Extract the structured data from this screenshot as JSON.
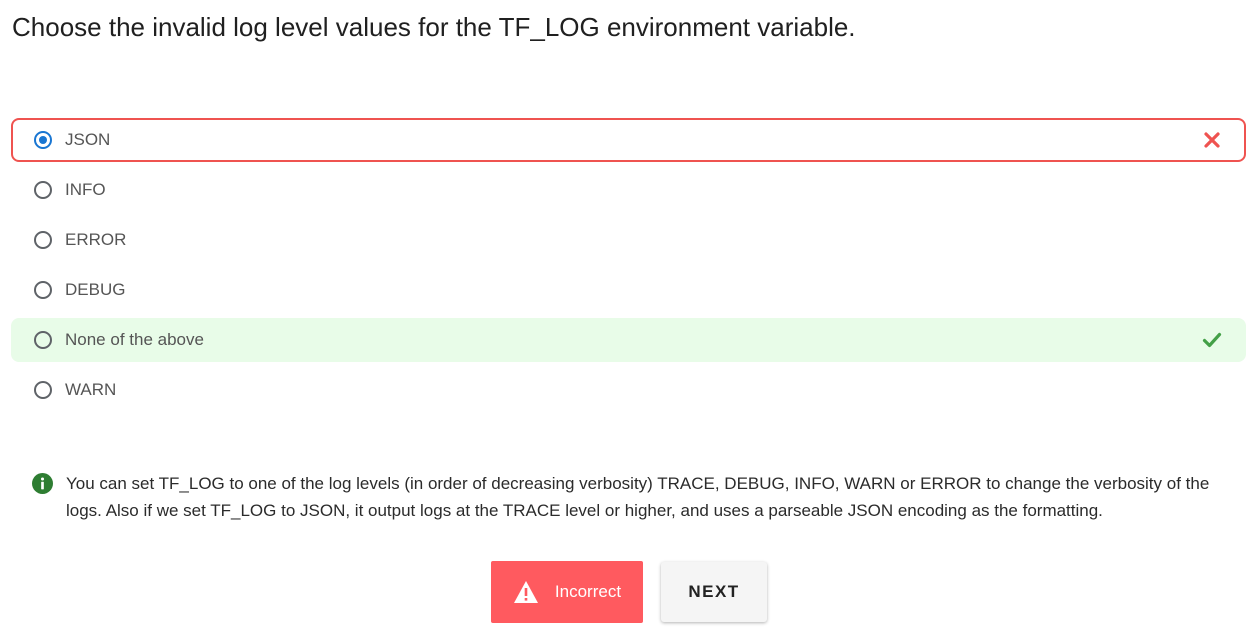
{
  "question": {
    "text": "Choose the invalid log level values for the TF_LOG environment variable."
  },
  "options": [
    {
      "label": "JSON",
      "selected": true,
      "state": "wrong"
    },
    {
      "label": "INFO",
      "selected": false,
      "state": "none"
    },
    {
      "label": "ERROR",
      "selected": false,
      "state": "none"
    },
    {
      "label": "DEBUG",
      "selected": false,
      "state": "none"
    },
    {
      "label": "None of the above",
      "selected": false,
      "state": "correct"
    },
    {
      "label": "WARN",
      "selected": false,
      "state": "none"
    }
  ],
  "explanation": {
    "icon": "info-icon",
    "text": "You can set TF_LOG to one of the log levels (in order of decreasing verbosity) TRACE, DEBUG, INFO, WARN or ERROR to change the verbosity of the logs. Also if we set TF_LOG to JSON, it output logs at the TRACE level or higher, and uses a parseable JSON encoding as the formatting."
  },
  "actions": {
    "incorrect_label": "Incorrect",
    "next_label": "NEXT"
  },
  "colors": {
    "wrong": "#ef5350",
    "correct_bg": "#e8fce8",
    "correct_check": "#43a047",
    "radio_selected": "#1976d2",
    "info": "#2e7d32",
    "incorrect_button": "#ff5a5f"
  }
}
